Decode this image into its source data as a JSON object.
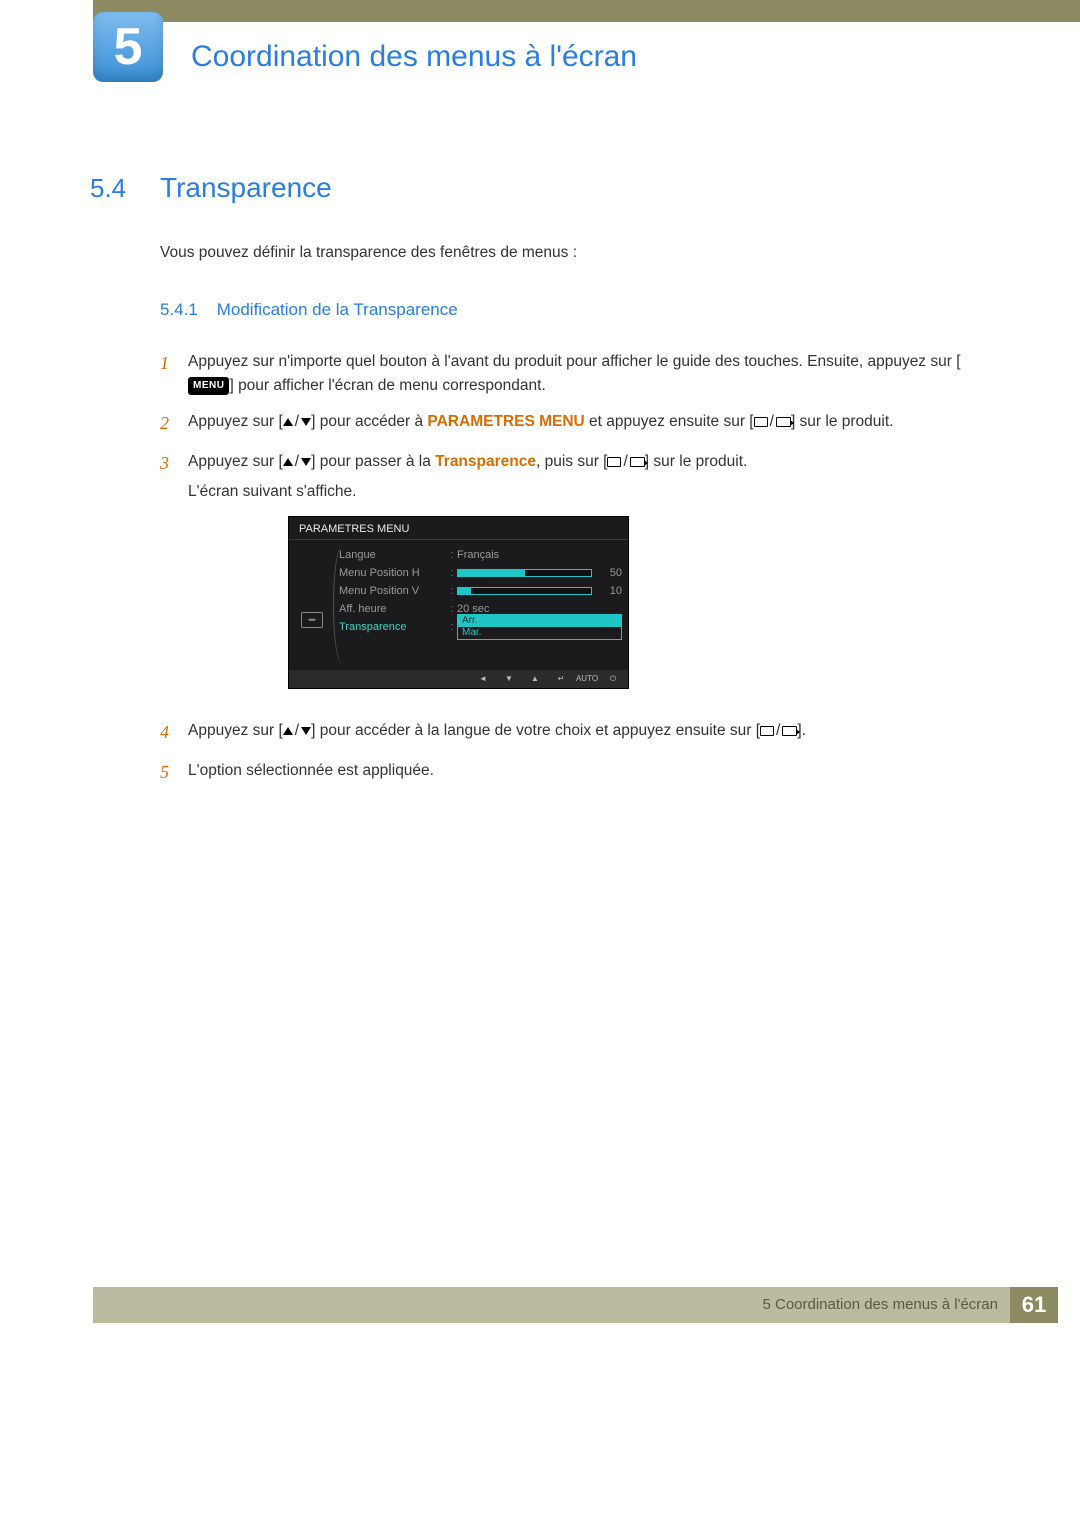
{
  "chapter": {
    "number": "5",
    "title": "Coordination des menus à l'écran"
  },
  "section": {
    "number": "5.4",
    "title": "Transparence",
    "intro": "Vous pouvez définir la transparence des fenêtres de menus :"
  },
  "subsection": {
    "number": "5.4.1",
    "title": "Modification de la Transparence"
  },
  "steps": {
    "s1": {
      "num": "1",
      "pre": "Appuyez sur n'importe quel bouton à l'avant du produit pour afficher le guide des touches. Ensuite, appuyez sur [",
      "menu": "MENU",
      "post": "] pour afficher l'écran de menu correspondant."
    },
    "s2": {
      "num": "2",
      "pre": "Appuyez sur [",
      "mid": "] pour accéder à ",
      "bold": "PARAMETRES MENU",
      "mid2": " et appuyez ensuite sur [",
      "post": "] sur le produit."
    },
    "s3": {
      "num": "3",
      "pre": "Appuyez sur [",
      "mid": "] pour passer à la ",
      "bold": "Transparence",
      "mid2": ", puis sur [",
      "post": "] sur le produit.",
      "tail": "L'écran suivant s'affiche."
    },
    "s4": {
      "num": "4",
      "pre": "Appuyez sur [",
      "mid": "] pour accéder à la langue de votre choix et appuyez ensuite sur [",
      "post": "]."
    },
    "s5": {
      "num": "5",
      "text": "L'option sélectionnée est appliquée."
    }
  },
  "osd": {
    "title": "PARAMETRES MENU",
    "rows": {
      "langue": {
        "label": "Langue",
        "value": "Français"
      },
      "posh": {
        "label": "Menu Position H",
        "value": "50",
        "pct": 50
      },
      "posv": {
        "label": "Menu Position V",
        "value": "10",
        "pct": 10
      },
      "aff": {
        "label": "Aff. heure",
        "value": "20 sec"
      },
      "trans": {
        "label": "Transparence",
        "opt1": "Arr.",
        "opt2": "Mar."
      }
    },
    "footer": {
      "auto": "AUTO"
    }
  },
  "footer": {
    "text": "5 Coordination des menus à l'écran",
    "page": "61"
  }
}
